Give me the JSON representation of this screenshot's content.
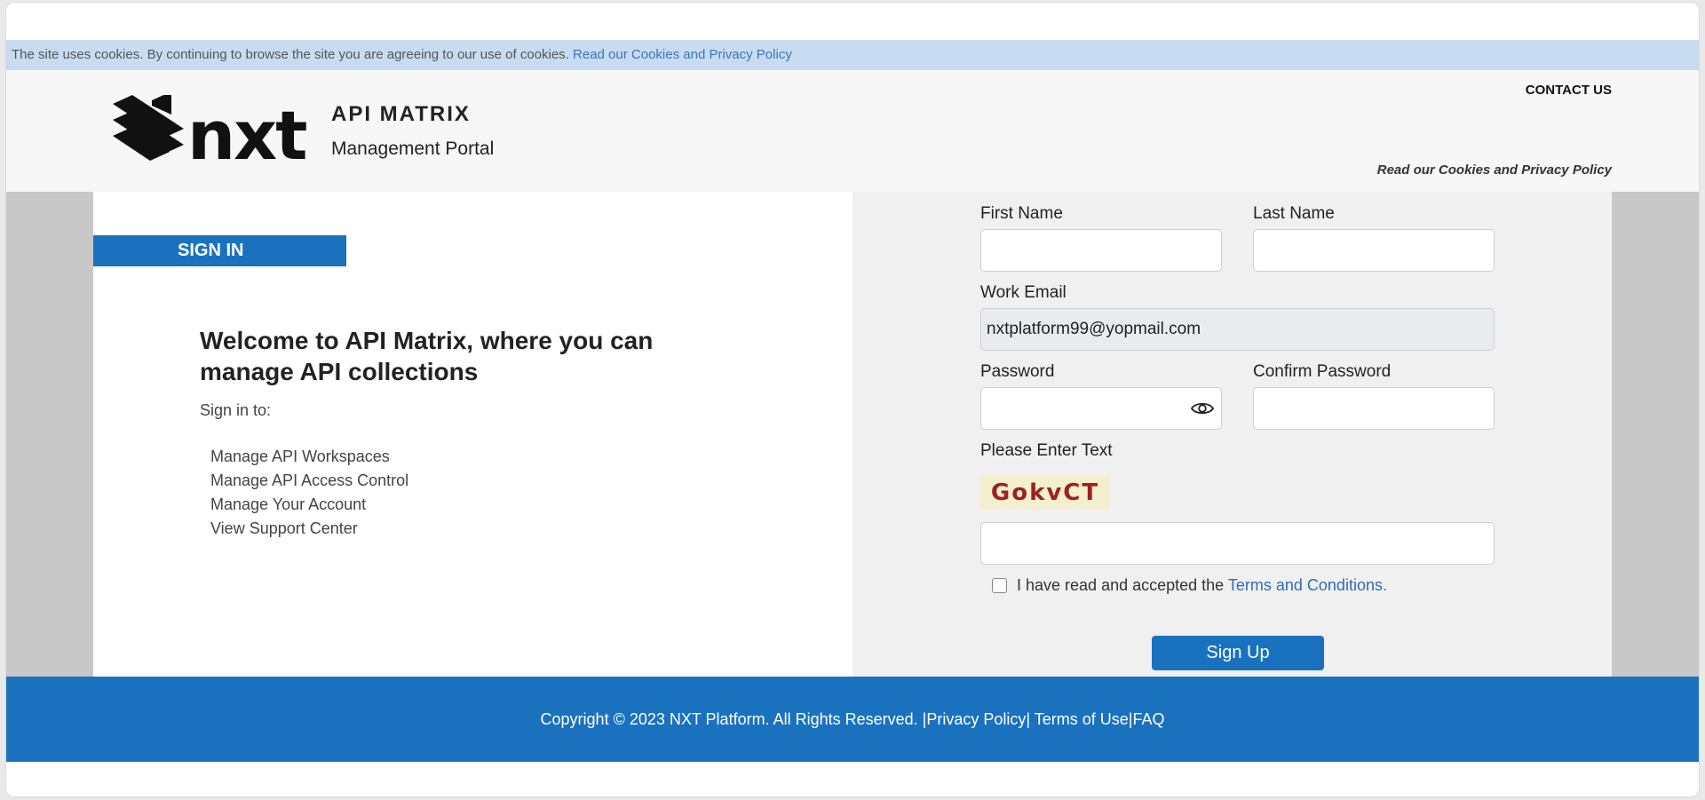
{
  "cookie_bar": {
    "text": "The site uses cookies. By continuing to browse the site you are agreeing to our use of cookies.",
    "link": "Read our Cookies and Privacy Policy"
  },
  "header": {
    "logo_icon": "nxt-logo",
    "brand_title": "API MATRIX",
    "brand_subtitle": "Management Portal",
    "contact": "CONTACT US",
    "policy_link": "Read our Cookies and Privacy Policy"
  },
  "left": {
    "tab_label": "SIGN IN",
    "welcome": "Welcome to API Matrix, where you can manage API collections",
    "signin_to": "Sign in to:",
    "features": [
      "Manage API Workspaces",
      "Manage API Access Control",
      "Manage Your Account",
      "View Support Center"
    ]
  },
  "form": {
    "first_name_label": "First Name",
    "first_name_value": "",
    "last_name_label": "Last Name",
    "last_name_value": "",
    "email_label": "Work Email",
    "email_value": "nxtplatform99@yopmail.com",
    "password_label": "Password",
    "password_value": "",
    "password_toggle_icon": "eye-icon",
    "confirm_password_label": "Confirm Password",
    "confirm_password_value": "",
    "captcha_label": "Please Enter Text",
    "captcha_text": "GokvCT",
    "captcha_value": "",
    "terms_prefix": "I have read and accepted the",
    "terms_link": "Terms and Conditions.",
    "terms_checked": false,
    "submit_label": "Sign Up"
  },
  "footer": {
    "copyright": "Copyright © 2023 NXT Platform. All Rights Reserved. |",
    "privacy": "Privacy Policy",
    "sep1": "| ",
    "terms": "Terms of Use",
    "sep2": "|",
    "faq": "FAQ"
  },
  "colors": {
    "brand_blue": "#1a72bf",
    "cookie_bar": "#c7dcf0",
    "link_blue": "#2e6db5",
    "captcha_text": "#9c2222"
  }
}
